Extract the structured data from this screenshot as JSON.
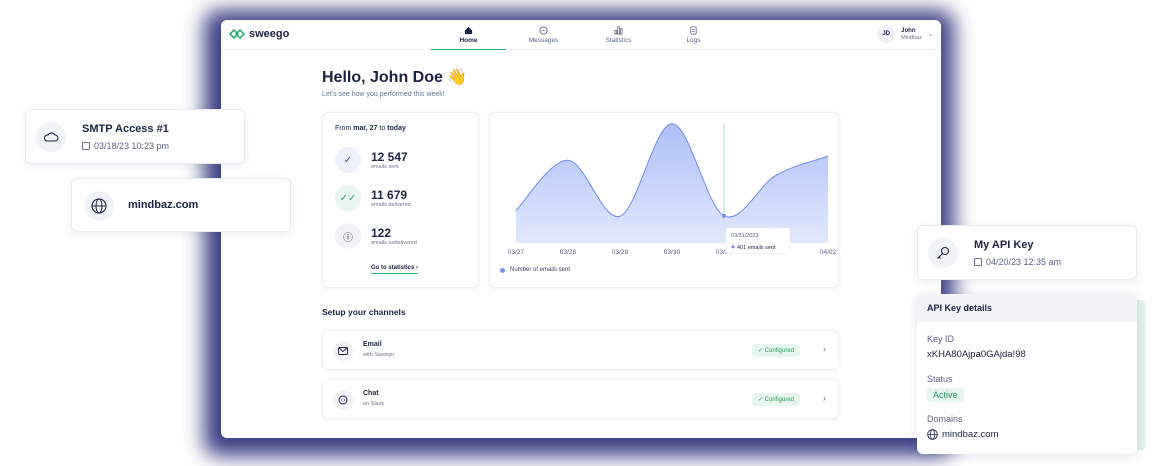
{
  "app": {
    "brand": "sweego",
    "nav": [
      {
        "label": "Home",
        "icon": "home-icon",
        "active": true
      },
      {
        "label": "Messages",
        "icon": "messages-icon",
        "active": false
      },
      {
        "label": "Statistics",
        "icon": "statistics-icon",
        "active": false
      },
      {
        "label": "Logs",
        "icon": "logs-icon",
        "active": false
      }
    ],
    "user": {
      "initials": "JD",
      "name": "John",
      "org": "Mindbaz"
    }
  },
  "greeting": {
    "title": "Hello, John Doe 👋",
    "subtitle": "Let's see how you performed this week!"
  },
  "stats": {
    "from_label": "From",
    "from_date": "mar, 27",
    "to_label": "to",
    "to_date": "today",
    "items": [
      {
        "value": "12 547",
        "label": "emails sent",
        "icon": "check-icon"
      },
      {
        "value": "11 679",
        "label": "emails delivered",
        "icon": "double-check-icon"
      },
      {
        "value": "122",
        "label": "emails undelivered",
        "icon": "alert-icon"
      }
    ],
    "link": "Go to statistics ›"
  },
  "chart_data": {
    "type": "area",
    "categories": [
      "03/27",
      "03/28",
      "03/29",
      "03/30",
      "03/31",
      "04/01",
      "04/02"
    ],
    "series": [
      {
        "name": "Number of emails sent",
        "values": [
          480,
          1220,
          395,
          1760,
          401,
          1000,
          1280
        ]
      }
    ],
    "ylim": [
      0,
      1800
    ],
    "tooltip": {
      "date": "03/31/2023",
      "text": "401 emails sent"
    },
    "legend": "bottom-left",
    "colors": {
      "fill": "#a9bdf8",
      "line": "#6f8ae8"
    }
  },
  "channels": {
    "title": "Setup your channels",
    "items": [
      {
        "name": "Email",
        "sub": "with Sweego",
        "status": "✓ Configured",
        "icon": "mail-icon"
      },
      {
        "name": "Chat",
        "sub": "on Slack",
        "status": "✓ Configured",
        "icon": "chat-icon"
      }
    ]
  },
  "float_cards": {
    "smtp": {
      "title": "SMTP Access #1",
      "date": "03/18/23 10:23 pm",
      "icon": "cloud-icon"
    },
    "domain": {
      "title": "mindbaz.com",
      "icon": "globe-icon"
    },
    "api": {
      "title": "My API Key",
      "date": "04/20/23 12:35 am",
      "icon": "key-icon"
    }
  },
  "api_details": {
    "header": "API Key details",
    "key_label": "Key ID",
    "key_value": "xKHA80Ajpa0GAjda!98",
    "status_label": "Status",
    "status_value": "Active",
    "domains_label": "Domains",
    "domain_value": "mindbaz.com"
  },
  "colors": {
    "accent": "#2fae74",
    "navy": "#1b2340",
    "glow": "#1a1f6e"
  }
}
